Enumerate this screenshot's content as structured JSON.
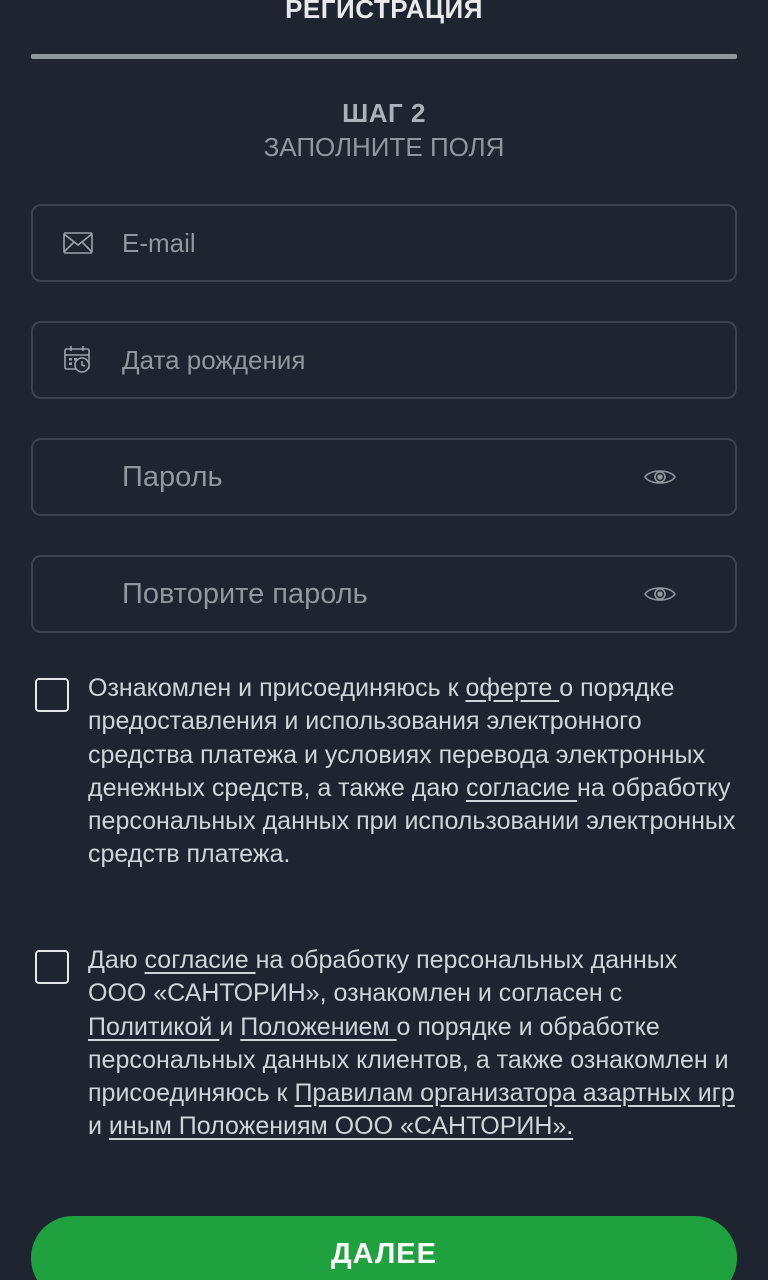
{
  "header": {
    "title": "РЕГИСТРАЦИЯ"
  },
  "step": {
    "title": "ШАГ 2",
    "subtitle": "ЗАПОЛНИТЕ ПОЛЯ"
  },
  "fields": {
    "email": {
      "placeholder": "E-mail",
      "icon": "envelope-icon"
    },
    "birthdate": {
      "placeholder": "Дата рождения",
      "icon": "calendar-clock-icon"
    },
    "password": {
      "placeholder": "Пароль",
      "icon": "eye-icon"
    },
    "password_repeat": {
      "placeholder": "Повторите пароль",
      "icon": "eye-icon"
    }
  },
  "agreement1": {
    "t1": "Ознакомлен и присоединяюсь к ",
    "link_offer": "оферте ",
    "t2": " о порядке предоставления и использования электронного средства платежа и условиях перевода электронных денежных средств, а также даю ",
    "link_consent": "согласие ",
    "t3": "на обработку персональных данных при использовании электронных средств платежа."
  },
  "agreement2": {
    "t1": "Даю ",
    "link_consent": " согласие ",
    "t2": " на обработку персональных данных ООО «САНТОРИН», ознакомлен и согласен с ",
    "link_policy": " Политикой ",
    "t3": " и ",
    "link_regulation": " Положением ",
    "t4": " о порядке и обработке персональных данных клиентов, а также ознакомлен и присоединяюсь к ",
    "link_rules": " Правилам организатора азартных игр ",
    "t5": " и ",
    "link_other": " иным Положениям ООО «САНТОРИН»."
  },
  "next_button": {
    "label": "ДАЛЕЕ"
  },
  "colors": {
    "background": "#1e2530",
    "field_border": "#3b4450",
    "accent_green": "#1fa140",
    "muted_text": "#8f979f"
  }
}
